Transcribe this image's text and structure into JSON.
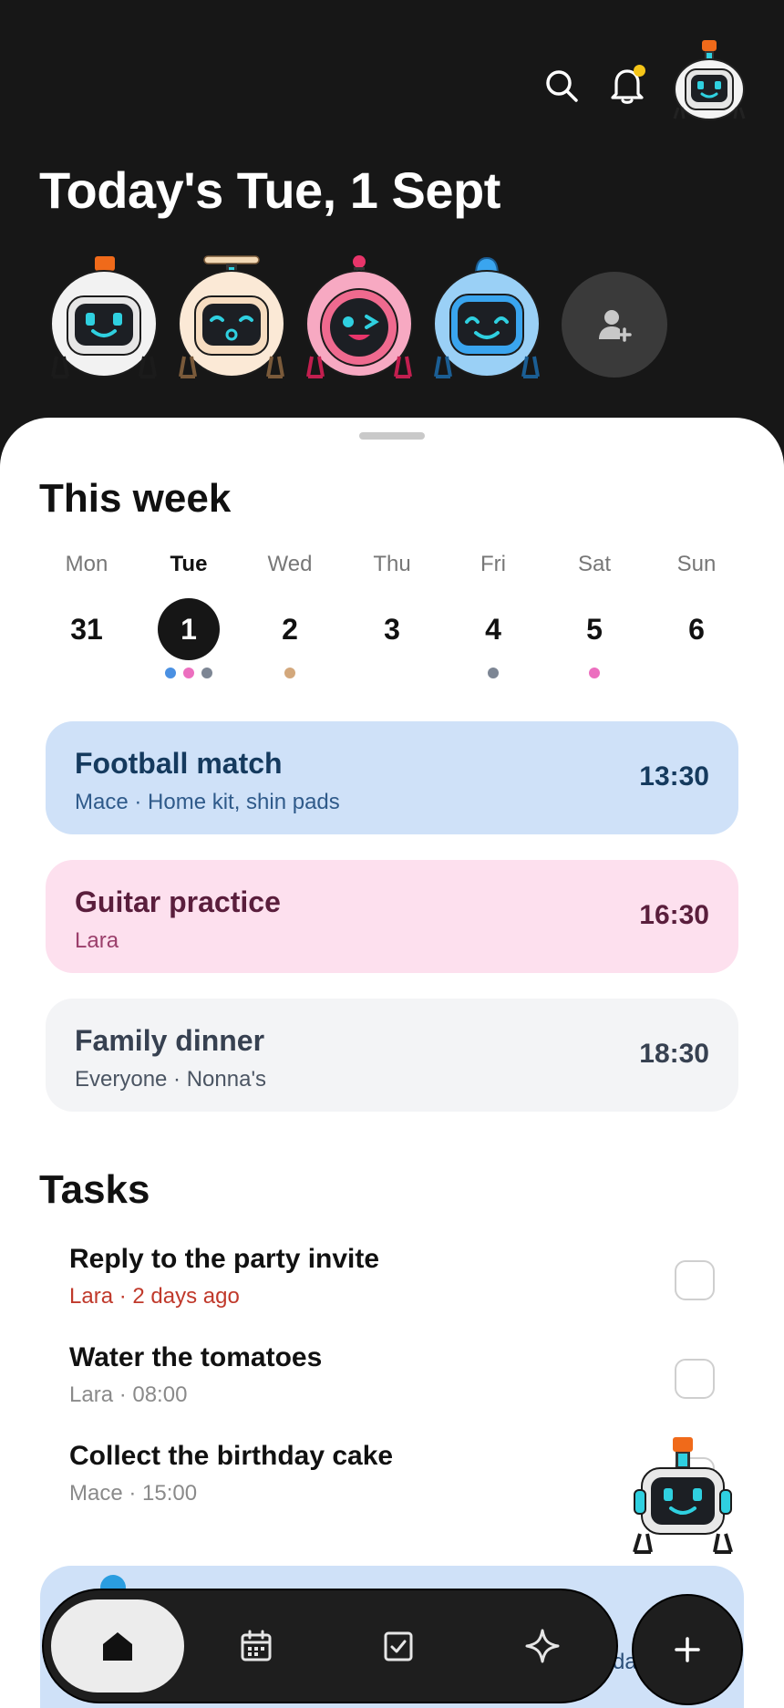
{
  "header": {
    "title": "Today's Tue, 1 Sept",
    "search_icon": "search-icon",
    "notification_icon": "bell-icon",
    "notification_badge_color": "#f5c518",
    "members": [
      {
        "avatar": "robot-white-avatar",
        "color": "#ffffff"
      },
      {
        "avatar": "robot-beige-propeller-avatar",
        "color": "#f6dcc0"
      },
      {
        "avatar": "robot-pink-avatar",
        "color": "#ef6a8f"
      },
      {
        "avatar": "robot-blue-avatar",
        "color": "#3aa5ef"
      }
    ],
    "add_member_icon": "add-person-icon"
  },
  "week": {
    "title": "This week",
    "days": [
      {
        "name": "Mon",
        "num": "31",
        "active": false,
        "dots": []
      },
      {
        "name": "Tue",
        "num": "1",
        "active": true,
        "dots": [
          "#4a90e2",
          "#ec6fbf",
          "#7d8694"
        ]
      },
      {
        "name": "Wed",
        "num": "2",
        "active": false,
        "dots": [
          "#d3a87c"
        ]
      },
      {
        "name": "Thu",
        "num": "3",
        "active": false,
        "dots": []
      },
      {
        "name": "Fri",
        "num": "4",
        "active": false,
        "dots": [
          "#7d8694"
        ]
      },
      {
        "name": "Sat",
        "num": "5",
        "active": false,
        "dots": [
          "#ec6fbf"
        ]
      },
      {
        "name": "Sun",
        "num": "6",
        "active": false,
        "dots": []
      }
    ]
  },
  "events": [
    {
      "title": "Football match",
      "subtitle": "Mace · Home kit, shin pads",
      "time": "13:30",
      "bg": "#cfe1f8",
      "fg": "#153a5e",
      "sub_fg": "#2f5a8a"
    },
    {
      "title": "Guitar practice",
      "subtitle": "Lara",
      "time": "16:30",
      "bg": "#fde0ee",
      "fg": "#5a1e3c",
      "sub_fg": "#9b3f6b"
    },
    {
      "title": "Family dinner",
      "subtitle": "Everyone · Nonna's",
      "time": "18:30",
      "bg": "#f3f4f6",
      "fg": "#374151",
      "sub_fg": "#4b5563"
    }
  ],
  "tasks": {
    "title": "Tasks",
    "items": [
      {
        "title": "Reply to the party invite",
        "meta": "Lara · 2 days ago",
        "overdue": true,
        "checked": false
      },
      {
        "title": "Water the tomatoes",
        "meta": "Lara · 08:00",
        "overdue": false,
        "checked": false
      },
      {
        "title": "Collect the birthday cake",
        "meta": "Mace · 15:00",
        "overdue": false,
        "checked": false
      }
    ]
  },
  "promo": {
    "partial_text": "day"
  },
  "nav": {
    "home_icon": "home-icon",
    "calendar_icon": "calendar-icon",
    "tasks_icon": "checkbox-icon",
    "assistant_icon": "sparkle-icon",
    "add_icon": "plus-icon"
  }
}
